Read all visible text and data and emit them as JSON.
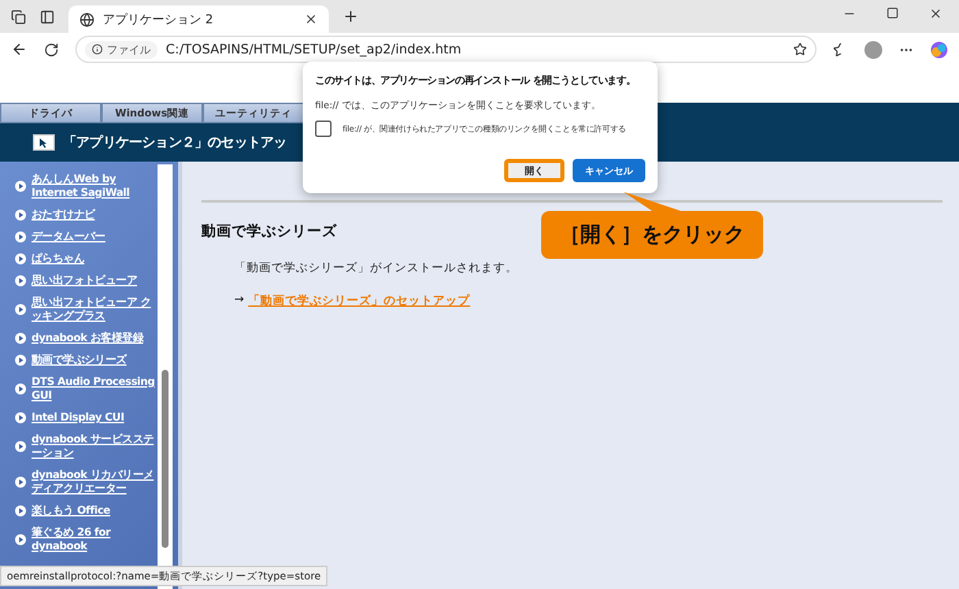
{
  "browser": {
    "tabs": [
      {
        "title": "アプリケーション 2",
        "selected": true
      }
    ],
    "address": {
      "scheme_label": "ファイル",
      "url": "C:/TOSAPINS/HTML/SETUP/set_ap2/index.htm"
    }
  },
  "page": {
    "nav_tabs": [
      "ドライバ",
      "Windows関連",
      "ユーティリティ"
    ],
    "header_title": "「アプリケーション２」のセットアッ",
    "sidebar": {
      "items": [
        {
          "label": "あんしんWeb by Internet SagiWall"
        },
        {
          "label": "おたすけナビ"
        },
        {
          "label": "データムーバー"
        },
        {
          "label": "ぱらちゃん"
        },
        {
          "label": "思い出フォトビューア"
        },
        {
          "label": "思い出フォトビューア クッキングプラス"
        },
        {
          "label": "dynabook お客様登録"
        },
        {
          "label": "動画で学ぶシリーズ"
        },
        {
          "label": "DTS Audio Processing GUI"
        },
        {
          "label": "Intel Display CUI"
        },
        {
          "label": "dynabook サービスステーション"
        },
        {
          "label": "dynabook リカバリーメディアクリエーター"
        },
        {
          "label": "楽しもう Office"
        },
        {
          "label": "筆ぐるめ 26 for dynabook"
        }
      ]
    },
    "content": {
      "heading": "動画で学ぶシリーズ",
      "description": "「動画で学ぶシリーズ」がインストールされます。",
      "link_prefix": "→",
      "link": "「動画で学ぶシリーズ」のセットアップ"
    }
  },
  "dialog": {
    "title": "このサイトは、アプリケーションの再インストール を開こうとしています。",
    "message": "file:// では、このアプリケーションを開くことを要求しています。",
    "checkbox": {
      "label": "file:// が、関連付けられたアプリでこの種類のリンクを開くことを常に許可する",
      "checked": false
    },
    "buttons": [
      {
        "label": "開く",
        "kind": "secondary",
        "highlighted": true
      },
      {
        "label": "キャンセル",
        "kind": "primary",
        "highlighted": false
      }
    ]
  },
  "callout": {
    "text": "［開く］をクリック"
  },
  "status_bar": {
    "text": "oemreinstallprotocol:?name=動画で学ぶシリーズ?type=store"
  }
}
